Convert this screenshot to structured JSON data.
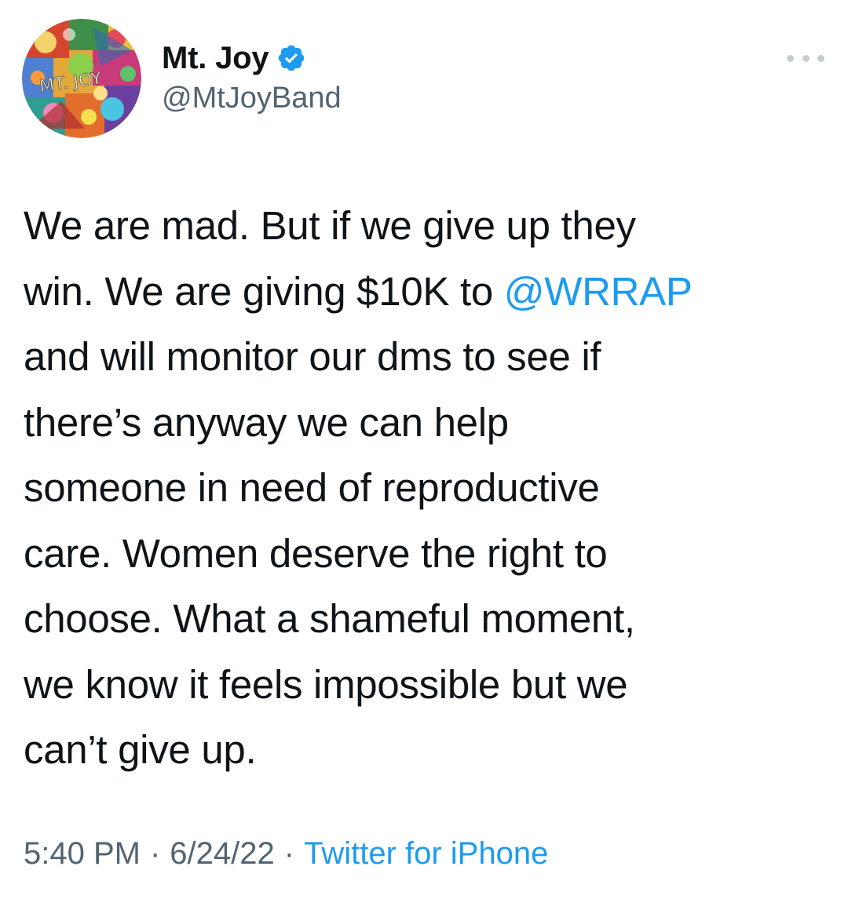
{
  "tweet": {
    "author": {
      "display_name": "Mt. Joy",
      "handle": "@MtJoyBand",
      "avatar_text": "MT. JOY",
      "verified": true
    },
    "body_lines": [
      {
        "pre": "We are mad. But if we give up they",
        "mention": "",
        "post": ""
      },
      {
        "pre": "win. We are giving $10K to ",
        "mention": "@WRRAP",
        "post": ""
      },
      {
        "pre": "and will monitor our dms to see if",
        "mention": "",
        "post": ""
      },
      {
        "pre": "there’s anyway we can help",
        "mention": "",
        "post": ""
      },
      {
        "pre": "someone in need of reproductive",
        "mention": "",
        "post": ""
      },
      {
        "pre": "care. Women deserve the right to",
        "mention": "",
        "post": ""
      },
      {
        "pre": "choose. What a shameful moment,",
        "mention": "",
        "post": ""
      },
      {
        "pre": "we know it feels impossible but we",
        "mention": "",
        "post": ""
      },
      {
        "pre": "can’t give up.",
        "mention": "",
        "post": ""
      }
    ],
    "time": "5:40 PM",
    "separator": "·",
    "date": "6/24/22",
    "source": "Twitter for iPhone"
  },
  "icons": {
    "verified": "verified-badge-icon",
    "more": "more-options-icon"
  },
  "colors": {
    "link": "#1d9bf0",
    "secondary_text": "#536471",
    "primary_text": "#0f1419"
  }
}
